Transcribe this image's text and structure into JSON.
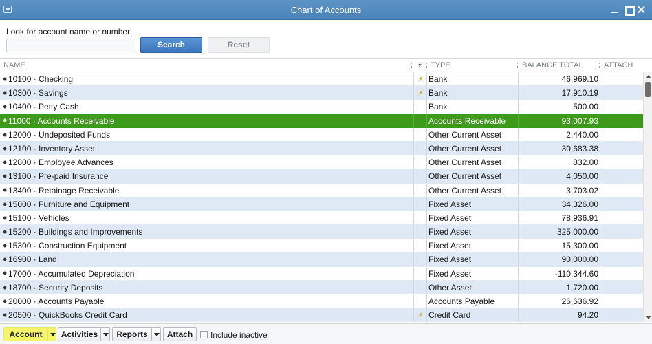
{
  "window": {
    "title": "Chart of Accounts"
  },
  "search": {
    "label": "Look for account name or number",
    "value": "",
    "placeholder": "",
    "search_label": "Search",
    "reset_label": "Reset"
  },
  "columns": {
    "name": "NAME",
    "flag": "⚡",
    "type": "TYPE",
    "balance": "BALANCE TOTAL",
    "attach": "ATTACH"
  },
  "accounts": [
    {
      "name": "10100 · Checking",
      "online": "⚡",
      "type": "Bank",
      "balance": "46,969.10"
    },
    {
      "name": "10300 · Savings",
      "online": "⚡",
      "type": "Bank",
      "balance": "17,910.19"
    },
    {
      "name": "10400 · Petty Cash",
      "online": "",
      "type": "Bank",
      "balance": "500.00"
    },
    {
      "name": "11000 · Accounts Receivable",
      "online": "",
      "type": "Accounts Receivable",
      "balance": "93,007.93",
      "selected": true
    },
    {
      "name": "12000 · Undeposited Funds",
      "online": "",
      "type": "Other Current Asset",
      "balance": "2,440.00"
    },
    {
      "name": "12100 · Inventory Asset",
      "online": "",
      "type": "Other Current Asset",
      "balance": "30,683.38"
    },
    {
      "name": "12800 · Employee Advances",
      "online": "",
      "type": "Other Current Asset",
      "balance": "832.00"
    },
    {
      "name": "13100 · Pre-paid Insurance",
      "online": "",
      "type": "Other Current Asset",
      "balance": "4,050.00"
    },
    {
      "name": "13400 · Retainage Receivable",
      "online": "",
      "type": "Other Current Asset",
      "balance": "3,703.02"
    },
    {
      "name": "15000 · Furniture and Equipment",
      "online": "",
      "type": "Fixed Asset",
      "balance": "34,326.00"
    },
    {
      "name": "15100 · Vehicles",
      "online": "",
      "type": "Fixed Asset",
      "balance": "78,936.91"
    },
    {
      "name": "15200 · Buildings and Improvements",
      "online": "",
      "type": "Fixed Asset",
      "balance": "325,000.00"
    },
    {
      "name": "15300 · Construction Equipment",
      "online": "",
      "type": "Fixed Asset",
      "balance": "15,300.00"
    },
    {
      "name": "16900 · Land",
      "online": "",
      "type": "Fixed Asset",
      "balance": "90,000.00"
    },
    {
      "name": "17000 · Accumulated Depreciation",
      "online": "",
      "type": "Fixed Asset",
      "balance": "-110,344.60"
    },
    {
      "name": "18700 · Security Deposits",
      "online": "",
      "type": "Other Asset",
      "balance": "1,720.00"
    },
    {
      "name": "20000 · Accounts Payable",
      "online": "",
      "type": "Accounts Payable",
      "balance": "26,636.92"
    },
    {
      "name": "20500 · QuickBooks Credit Card",
      "online": "⚡",
      "type": "Credit Card",
      "balance": "94.20"
    }
  ],
  "toolbar": {
    "account_label": "Account",
    "activities_label": "Activities",
    "reports_label": "Reports",
    "attach_label": "Attach",
    "include_inactive_label": "Include inactive",
    "include_inactive_checked": false
  },
  "colors": {
    "titlebar": "#5c93c5",
    "selected_row": "#3e9a1a",
    "alt_row": "#dfe9f5",
    "search_button": "#3a76bd",
    "highlight": "#f6f66a",
    "online_icon": "#d8a400"
  },
  "icons": {
    "system_menu": "system-menu-icon",
    "online_banking": "lightning-icon",
    "row_marker": "diamond-bullet-icon",
    "dropdown": "caret-down-icon"
  }
}
